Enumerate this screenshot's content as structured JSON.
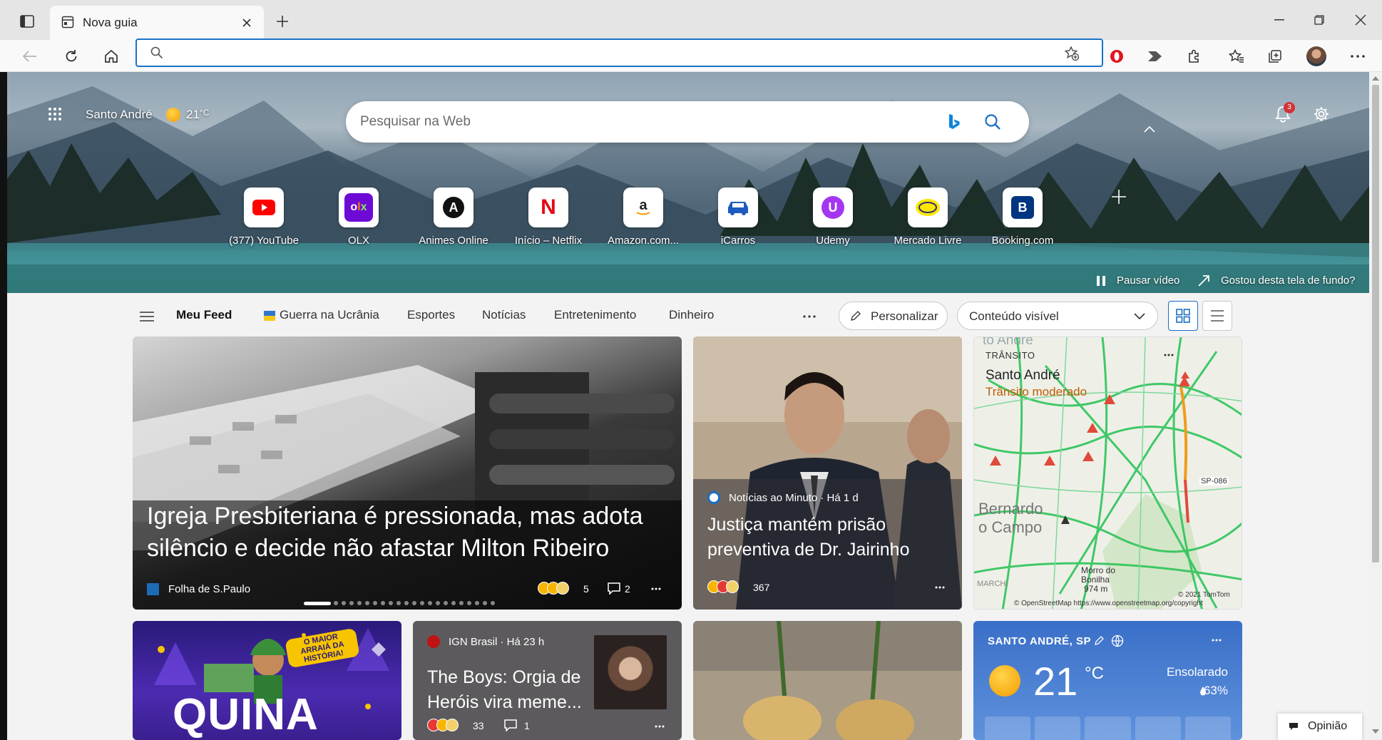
{
  "tab": {
    "title": "Nova guia"
  },
  "address": {
    "value": ""
  },
  "hero": {
    "location": "Santo André",
    "temp": "21",
    "temp_unit": "°C",
    "search_placeholder": "Pesquisar na Web",
    "notifications_count": "3",
    "pause_video": "Pausar vídeo",
    "like_background": "Gostou desta tela de fundo?"
  },
  "quick_links": [
    {
      "label": "(377) YouTube",
      "icon": "youtube-icon",
      "color": "#ff0000"
    },
    {
      "label": "OLX",
      "icon": "olx-icon",
      "color": "#6e0ad6"
    },
    {
      "label": "Animes Online",
      "icon": "animes-online-icon",
      "color": "#111111"
    },
    {
      "label": "Início – Netflix",
      "icon": "netflix-icon",
      "color": "#e50914"
    },
    {
      "label": "Amazon.com...",
      "icon": "amazon-icon",
      "color": "#222222"
    },
    {
      "label": "iCarros",
      "icon": "icarros-icon",
      "color": "#1e5bbf"
    },
    {
      "label": "Udemy",
      "icon": "udemy-icon",
      "color": "#a435f0"
    },
    {
      "label": "Mercado Livre",
      "icon": "mercado-livre-icon",
      "color": "#ffe600"
    },
    {
      "label": "Booking.com",
      "icon": "booking-icon",
      "color": "#003580"
    }
  ],
  "feed_nav": {
    "my_feed": "Meu Feed",
    "items": [
      "Guerra na Ucrânia",
      "Esportes",
      "Notícias",
      "Entretenimento",
      "Dinheiro"
    ],
    "personalize": "Personalizar",
    "content_select": "Conteúdo visível"
  },
  "cards": {
    "main": {
      "headline": "Igreja Presbiteriana é pressionada, mas adota silêncio e decide não afastar Milton Ribeiro",
      "source": "Folha de S.Paulo",
      "reactions": "5",
      "comments": "2"
    },
    "second": {
      "source": "Notícias ao Minuto · Há 1 d",
      "headline": "Justiça mantém prisão preventiva de Dr. Jairinho",
      "reactions": "367"
    },
    "traffic": {
      "label": "TRÂNSITO",
      "city": "Santo André",
      "status": "Trânsito moderado",
      "map_labels": [
        "Bernardo",
        "o Campo",
        "Morro do",
        "Bonilha",
        "974 m",
        "SP-086",
        "MARCHI",
        "to André"
      ],
      "copyright_tomtom": "© 2021 TomTom",
      "copyright_osm": "© OpenStreetMap https://www.openstreetmap.org/copyright",
      "status_color": "#c05b00"
    },
    "quina": {
      "title": "QUINA",
      "badge": "O MAIOR ARRAIÁ DA HISTÓRIA!"
    },
    "ign": {
      "source": "IGN Brasil · Há 23 h",
      "headline": "The Boys: Orgia de Heróis vira meme...",
      "reactions": "33",
      "comments": "1"
    },
    "weather": {
      "location": "SANTO ANDRÉ, SP",
      "temp": "21",
      "unit": "°C",
      "condition": "Ensolarado",
      "humidity": "63%"
    }
  },
  "feedback": "Opinião"
}
